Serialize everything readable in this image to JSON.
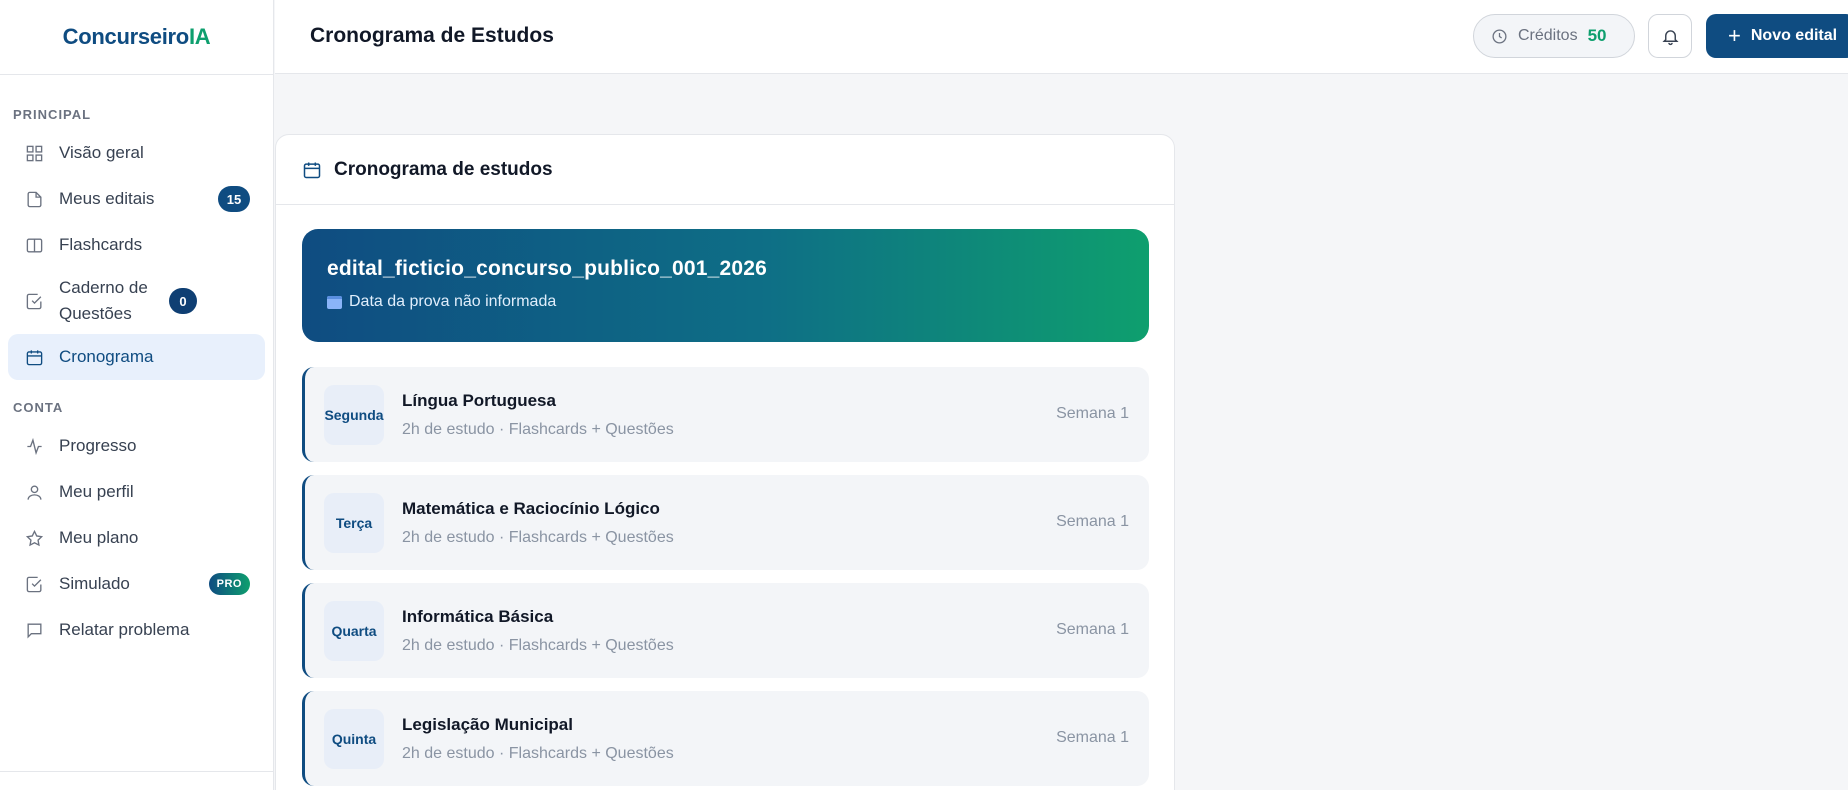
{
  "brand": {
    "part1": "Concurseiro",
    "part2": "IA"
  },
  "sidebar": {
    "principal_label": "PRINCIPAL",
    "conta_label": "CONTA",
    "items": [
      {
        "label": "Visão geral",
        "icon": "grid-icon"
      },
      {
        "label": "Meus editais",
        "icon": "file-icon",
        "badge": "15"
      },
      {
        "label": "Flashcards",
        "icon": "columns-icon"
      },
      {
        "label": "Caderno de Questões",
        "icon": "checkbox-icon",
        "badge": "0"
      },
      {
        "label": "Cronograma",
        "icon": "calendar-icon",
        "active": true
      },
      {
        "label": "Progresso",
        "icon": "activity-icon"
      },
      {
        "label": "Meu perfil",
        "icon": "user-icon"
      },
      {
        "label": "Meu plano",
        "icon": "star-icon"
      },
      {
        "label": "Simulado",
        "icon": "checkbox-icon",
        "badge": "PRO"
      },
      {
        "label": "Relatar problema",
        "icon": "message-icon"
      }
    ]
  },
  "header": {
    "title": "Cronograma de Estudos",
    "credits_label": "Créditos",
    "credits_value": "50",
    "new_button": "Novo edital"
  },
  "card": {
    "title": "Cronograma de estudos",
    "hero_title": "edital_ficticio_concurso_publico_001_2026",
    "hero_subtitle": "Data da prova não informada",
    "rows": [
      {
        "day": "Segunda",
        "subject": "Língua Portuguesa",
        "meta": "2h de estudo · Flashcards + Questões",
        "week": "Semana 1"
      },
      {
        "day": "Terça",
        "subject": "Matemática e Raciocínio Lógico",
        "meta": "2h de estudo · Flashcards + Questões",
        "week": "Semana 1"
      },
      {
        "day": "Quarta",
        "subject": "Informática Básica",
        "meta": "2h de estudo · Flashcards + Questões",
        "week": "Semana 1"
      },
      {
        "day": "Quinta",
        "subject": "Legislação Municipal",
        "meta": "2h de estudo · Flashcards + Questões",
        "week": "Semana 1"
      }
    ]
  },
  "colors": {
    "primary": "#0f4c81",
    "accent": "#0e9f6e",
    "active_bg": "#e8f0fc"
  }
}
